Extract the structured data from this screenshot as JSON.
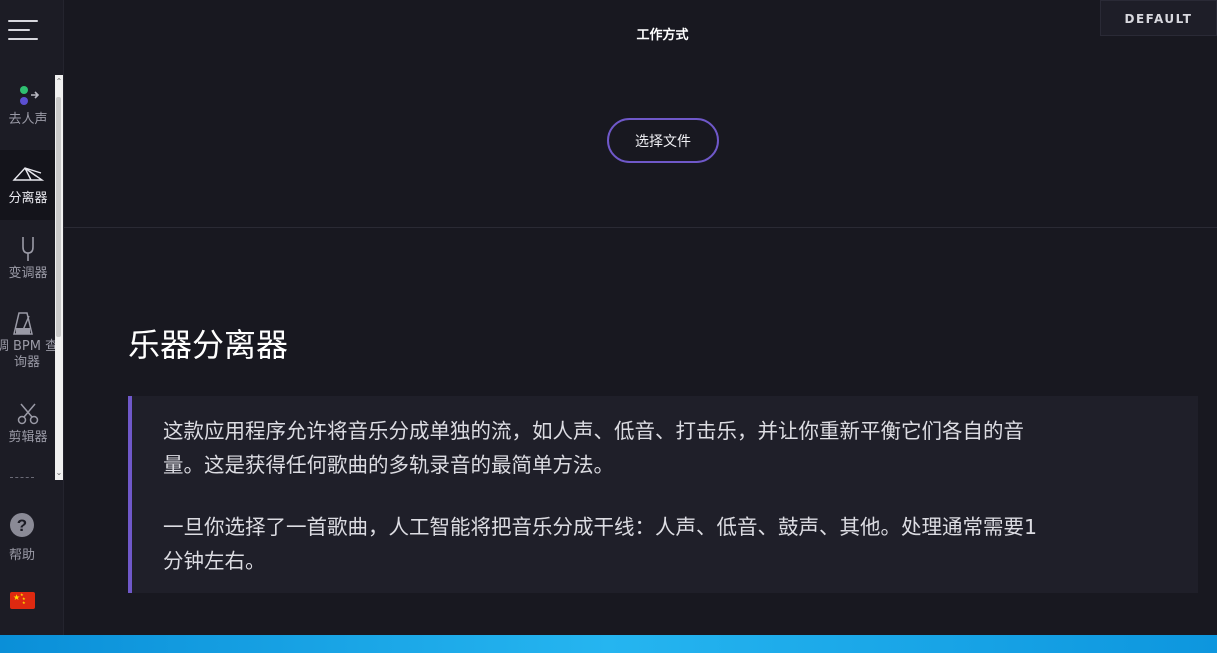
{
  "header": {
    "title": "工作方式",
    "preset_label": "DEFAULT"
  },
  "sidebar": {
    "items": [
      {
        "label": "去人声",
        "icon": "vocal-remover-icon",
        "active": false
      },
      {
        "label": "分离器",
        "icon": "splitter-icon",
        "active": true
      },
      {
        "label": "变调器",
        "icon": "tuning-fork-icon",
        "active": false
      },
      {
        "label": "调 BPM 查询器",
        "icon": "metronome-icon",
        "active": false
      },
      {
        "label": "剪辑器",
        "icon": "scissors-icon",
        "active": false
      }
    ],
    "help_label": "帮助",
    "help_icon": "question-circle-icon",
    "language_icon": "china-flag-icon"
  },
  "upload": {
    "button_label": "选择文件"
  },
  "article": {
    "heading": "乐器分离器",
    "paragraph1_line1": "这款应用程序允许将音乐分成单独的流，如人声、低音、打击乐，并让你重新平衡它们各自的音",
    "paragraph1_line2": "量。这是获得任何歌曲的多轨录音的最简单方法。",
    "paragraph2_line1": "一旦你选择了一首歌曲，人工智能将把音乐分成干线：人声、低音、鼓声、其他。处理通常需要1",
    "paragraph2_line2": "分钟左右。"
  },
  "colors": {
    "accent": "#6f58c9",
    "background": "#181820",
    "sidebar": "#1c1c25"
  }
}
